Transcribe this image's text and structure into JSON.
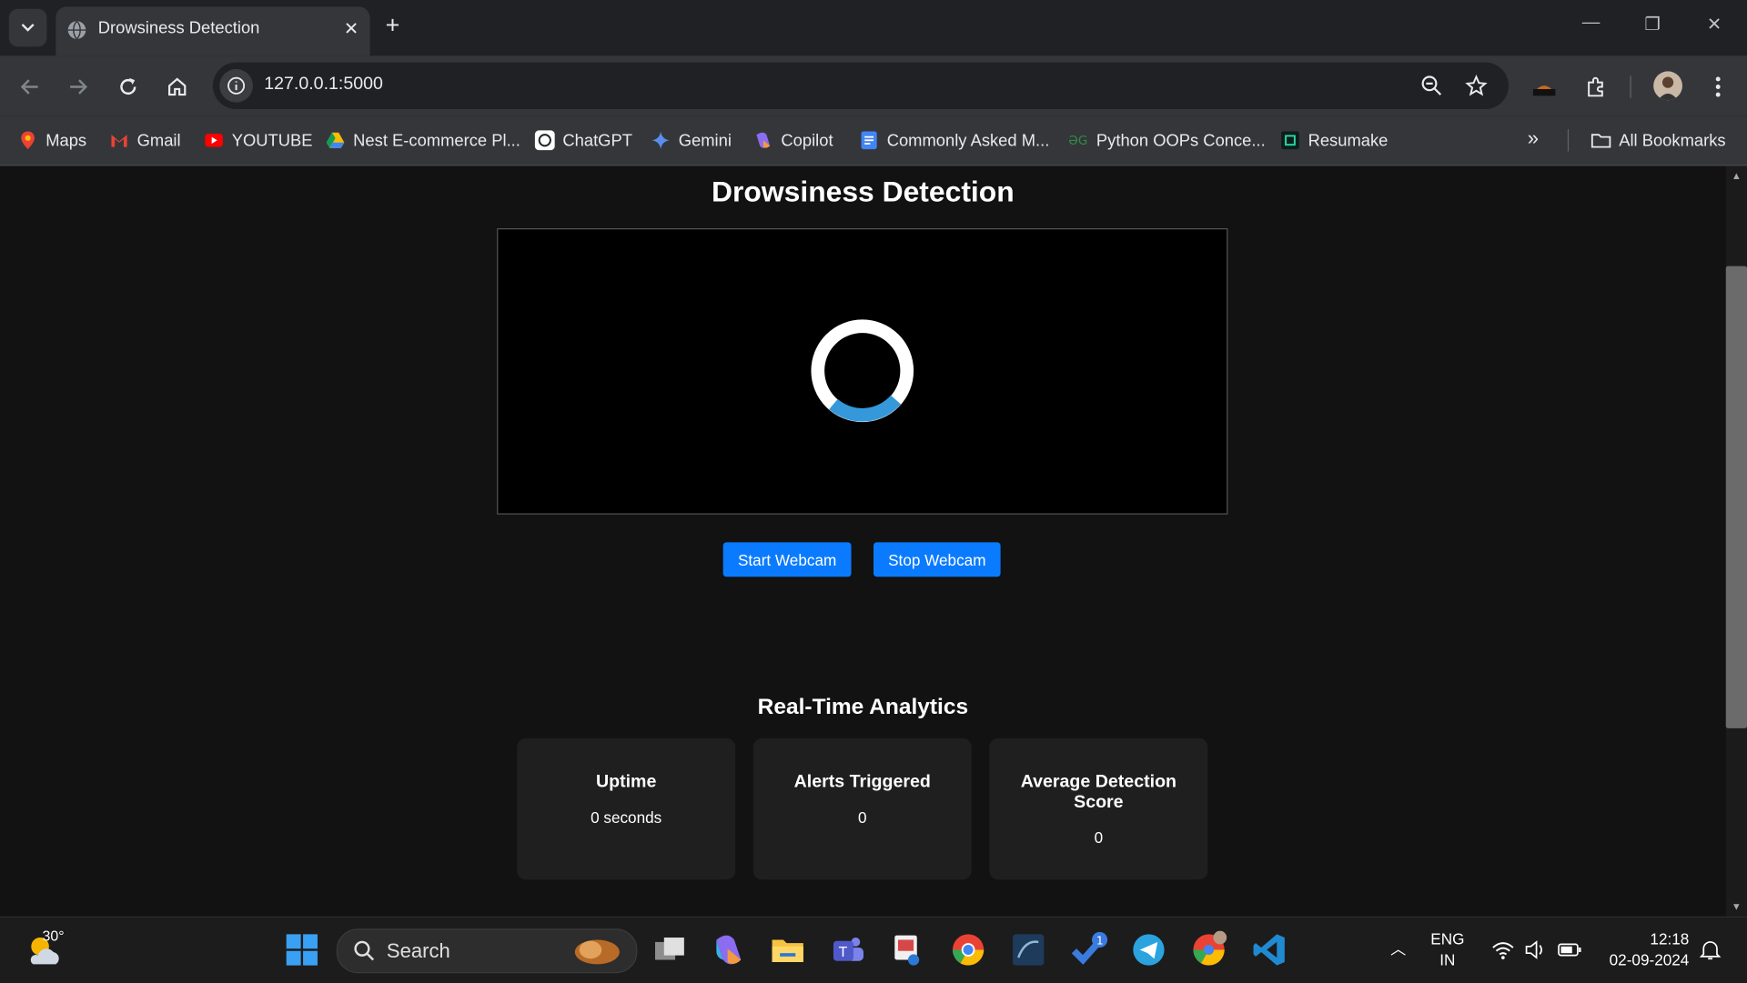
{
  "browser": {
    "tab_title": "Drowsiness Detection",
    "url": "127.0.0.1:5000",
    "bookmarks": [
      "Maps",
      "Gmail",
      "YOUTUBE",
      "Nest E-commerce Pl...",
      "ChatGPT",
      "Gemini",
      "Copilot",
      "Commonly Asked M...",
      "Python OOPs Conce...",
      "Resumake"
    ],
    "all_bookmarks": "All Bookmarks"
  },
  "page": {
    "title": "Drowsiness Detection",
    "start_button": "Start Webcam",
    "stop_button": "Stop Webcam",
    "analytics_title": "Real-Time Analytics",
    "cards": [
      {
        "label": "Uptime",
        "value": "0 seconds"
      },
      {
        "label": "Alerts Triggered",
        "value": "0"
      },
      {
        "label": "Average Detection Score",
        "value": "0"
      }
    ]
  },
  "taskbar": {
    "weather_temp": "30°",
    "search_label": "Search",
    "lang": "ENG",
    "region": "IN",
    "time": "12:18",
    "date": "02-09-2024",
    "badge": "1"
  },
  "colors": {
    "accent": "#0a7bff",
    "spinner_track": "#ffffff",
    "spinner_arc": "#3498db"
  }
}
